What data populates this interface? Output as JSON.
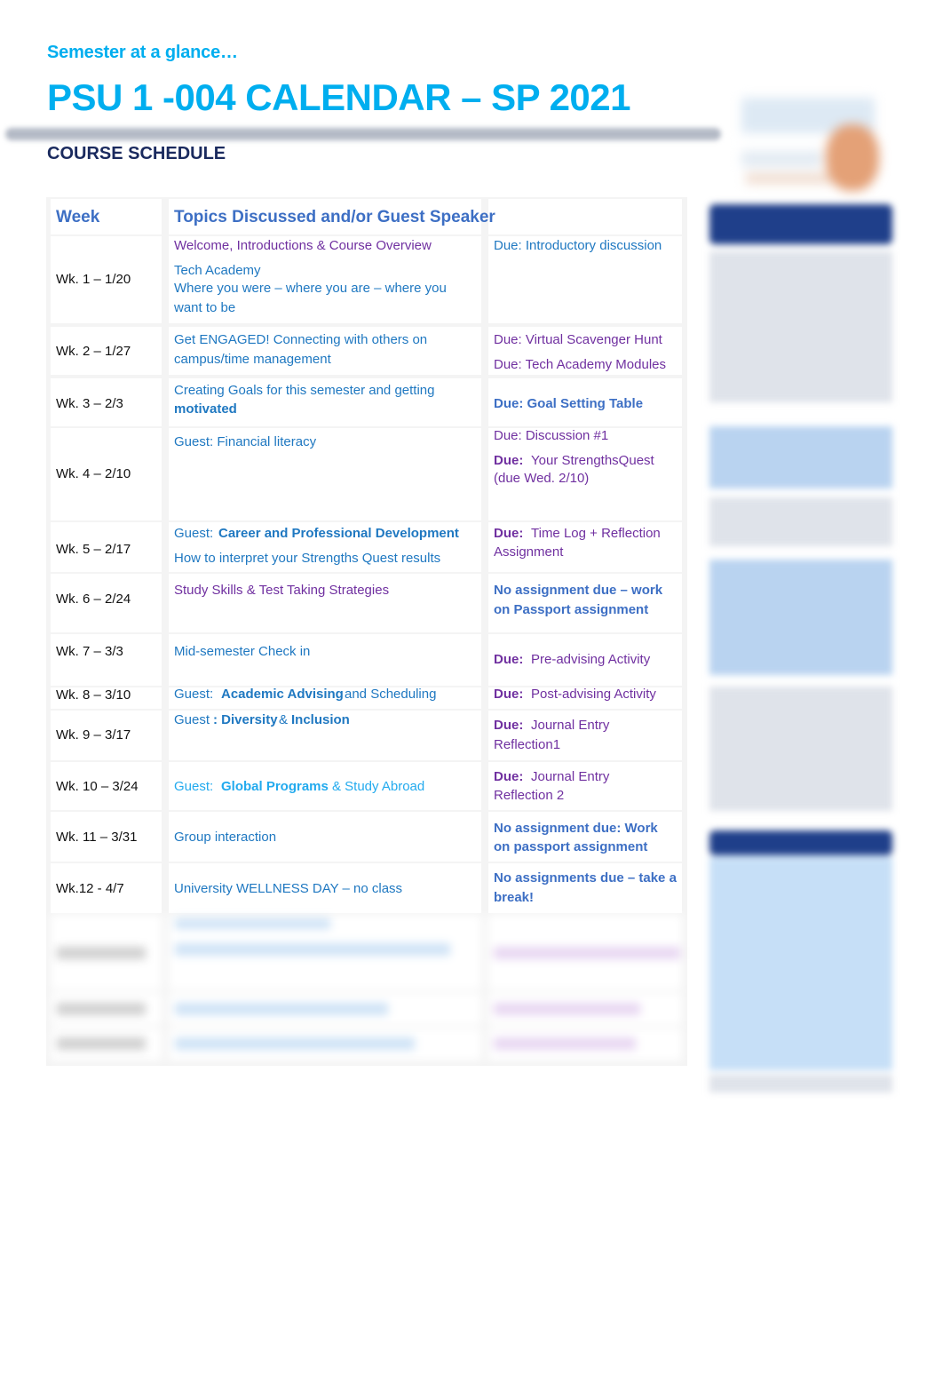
{
  "header": {
    "subtitle": "Semester at a glance…",
    "title": "PSU 1 -004 CALENDAR – SP 2021",
    "section": "COURSE SCHEDULE"
  },
  "table": {
    "headers": [
      "Week",
      "Topics Discussed and/or Guest Speaker",
      ""
    ],
    "rows": [
      {
        "week": "Wk. 1 – 1/20",
        "topics": [
          "Welcome, Introductions & Course Overview",
          "Tech Academy",
          "Where you were – where you are – where you",
          "want to be"
        ],
        "due": [
          "Due: Introductory discussion"
        ]
      },
      {
        "week": "Wk. 2 – 1/27",
        "topics": [
          "Get ENGAGED! Connecting with others on",
          "campus/time management"
        ],
        "due": [
          "Due: Virtual Scavenger Hunt",
          "Due: Tech Academy Modules"
        ]
      },
      {
        "week": "Wk. 3 – 2/3",
        "topics": [
          "Creating Goals for this semester and getting",
          "motivated"
        ],
        "due": [
          "Due: Goal Setting Table"
        ]
      },
      {
        "week": "Wk. 4 – 2/10",
        "topics": [
          "Guest: Financial literacy"
        ],
        "due": [
          "Due: Discussion #1",
          "Due:",
          "Your StrengthsQuest",
          "(due Wed. 2/10)"
        ]
      },
      {
        "week": "Wk. 5 – 2/17",
        "topics": [
          "Guest:",
          "Career and Professional Development",
          "How to interpret your Strengths Quest results"
        ],
        "due": [
          "Due:",
          "Time Log + Reflection",
          "Assignment"
        ]
      },
      {
        "week": "Wk. 6 – 2/24",
        "topics": [
          "Study Skills & Test Taking Strategies"
        ],
        "due": [
          "No assignment due – work",
          "on Passport assignment"
        ]
      },
      {
        "week": "Wk. 7 – 3/3",
        "topics": [
          "Mid-semester Check in"
        ],
        "due": [
          "Due:",
          "Pre-advising Activity"
        ]
      },
      {
        "week": "Wk. 8 – 3/10",
        "topics": [
          "Guest:",
          "Academic Advising",
          "and Scheduling"
        ],
        "due": [
          "Due:",
          "Post-advising Activity"
        ]
      },
      {
        "week": "Wk. 9 – 3/17",
        "topics": [
          "Guest",
          ": Diversity",
          "&",
          "Inclusion"
        ],
        "due": [
          "Due:",
          "Journal Entry",
          "Reflection1"
        ]
      },
      {
        "week": "Wk. 10 – 3/24",
        "topics": [
          "Guest:",
          "Global Programs",
          "& Study Abroad"
        ],
        "due": [
          "Due:",
          "Journal Entry",
          "Reflection 2"
        ]
      },
      {
        "week": "Wk. 11 – 3/31",
        "topics": [
          "Group interaction"
        ],
        "due": [
          "No assignment due: Work",
          "on passport assignment"
        ]
      },
      {
        "week": "Wk.12 - 4/7",
        "topics": [
          "University WELLNESS DAY – no class"
        ],
        "due": [
          "No assignments due – take a",
          "break!"
        ]
      }
    ]
  }
}
